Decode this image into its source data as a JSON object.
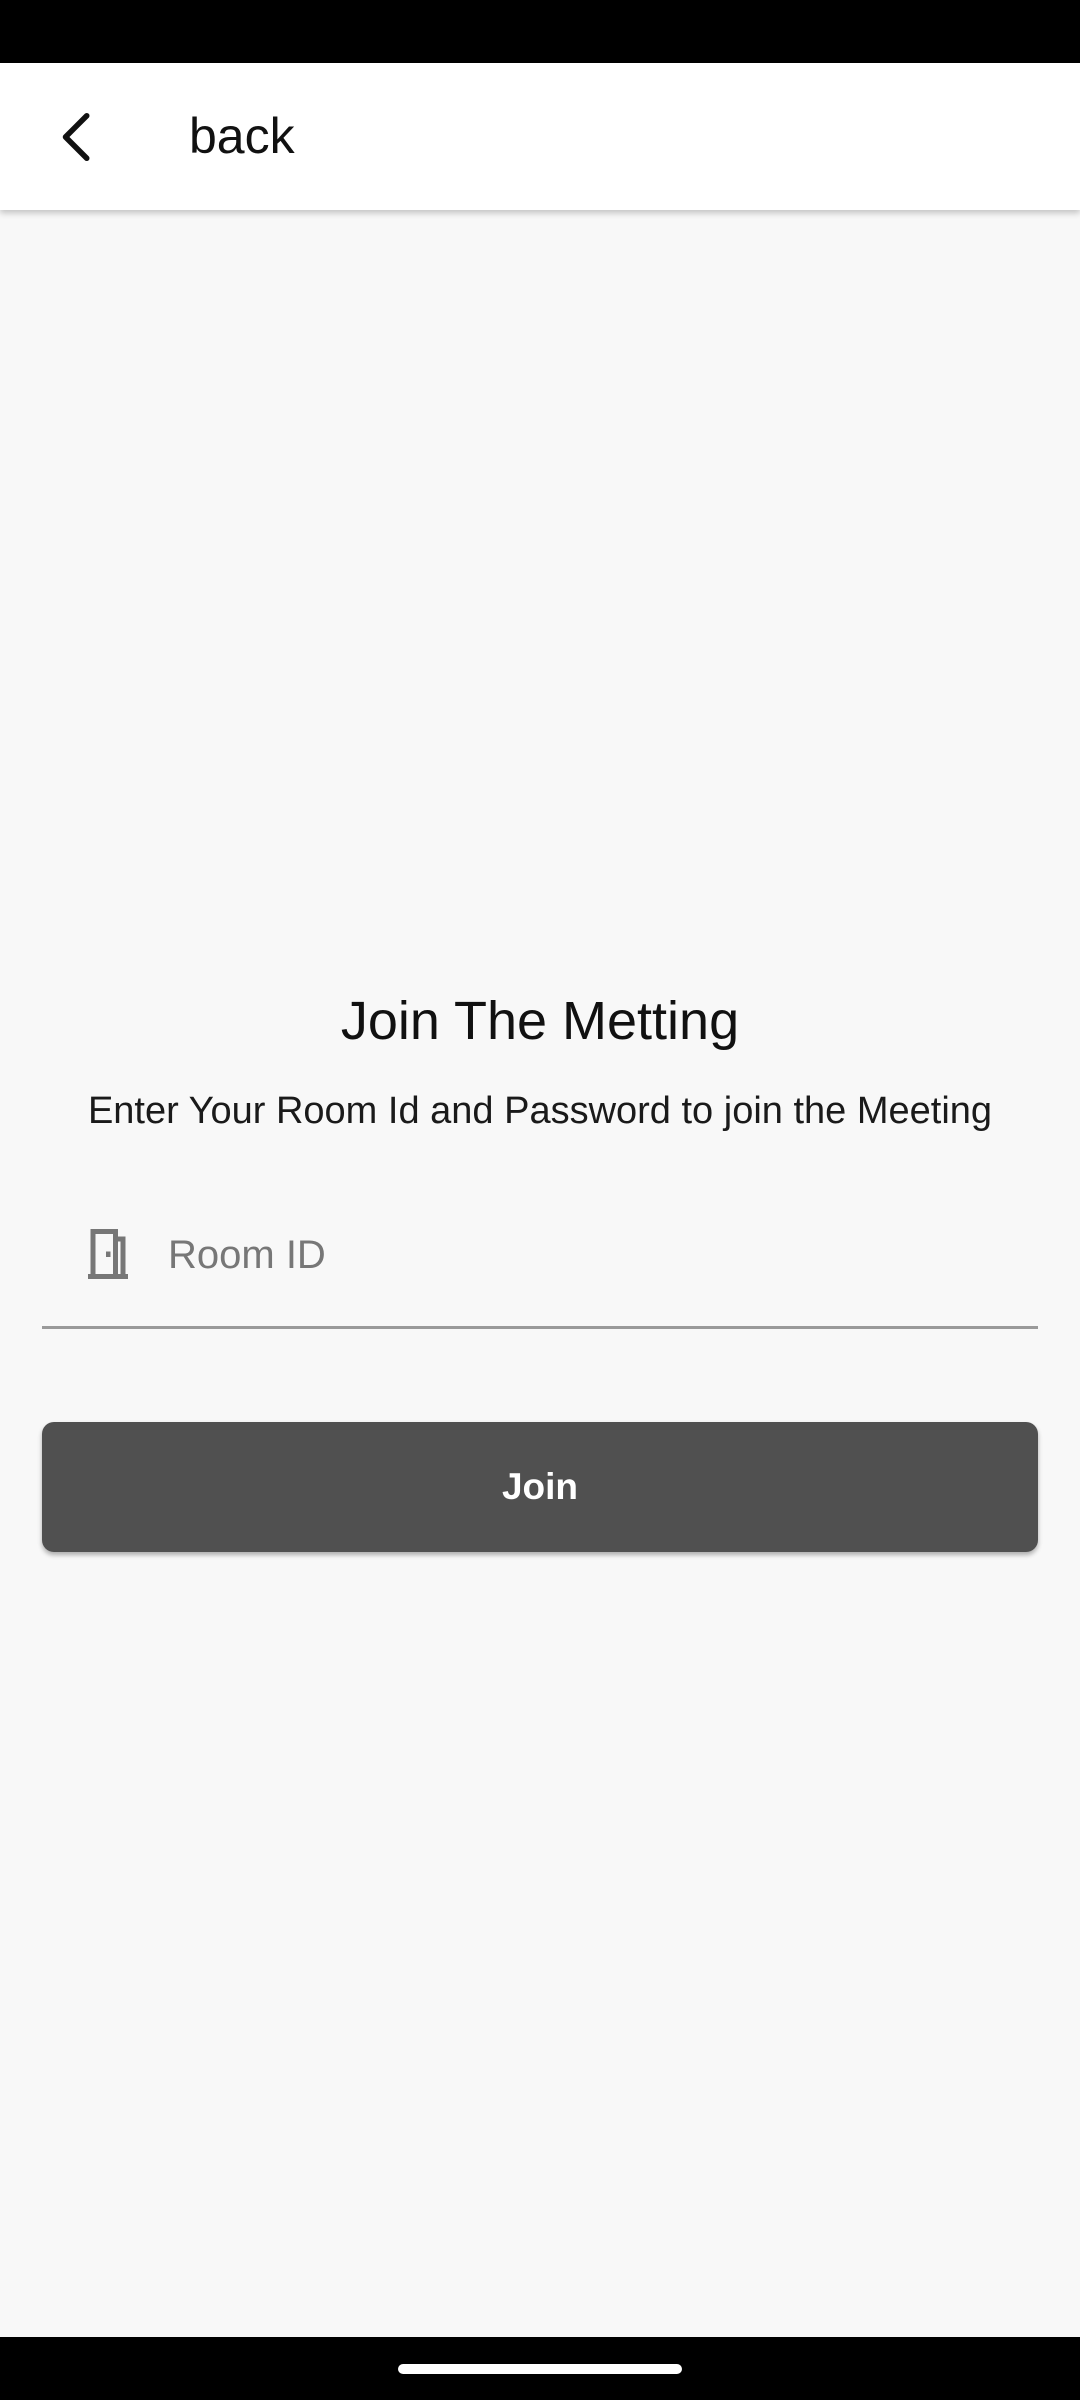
{
  "header": {
    "back_label": "back"
  },
  "main": {
    "title": "Join The Metting",
    "subtitle": "Enter Your Room Id and Password to join the Meeting",
    "room_id_field": {
      "placeholder": "Room ID",
      "value": "",
      "icon": "door-icon"
    },
    "join_button_label": "Join"
  },
  "colors": {
    "background": "#f8f8f8",
    "app_bar": "#ffffff",
    "button": "#505050",
    "button_text": "#ffffff",
    "system_bars": "#000000"
  }
}
